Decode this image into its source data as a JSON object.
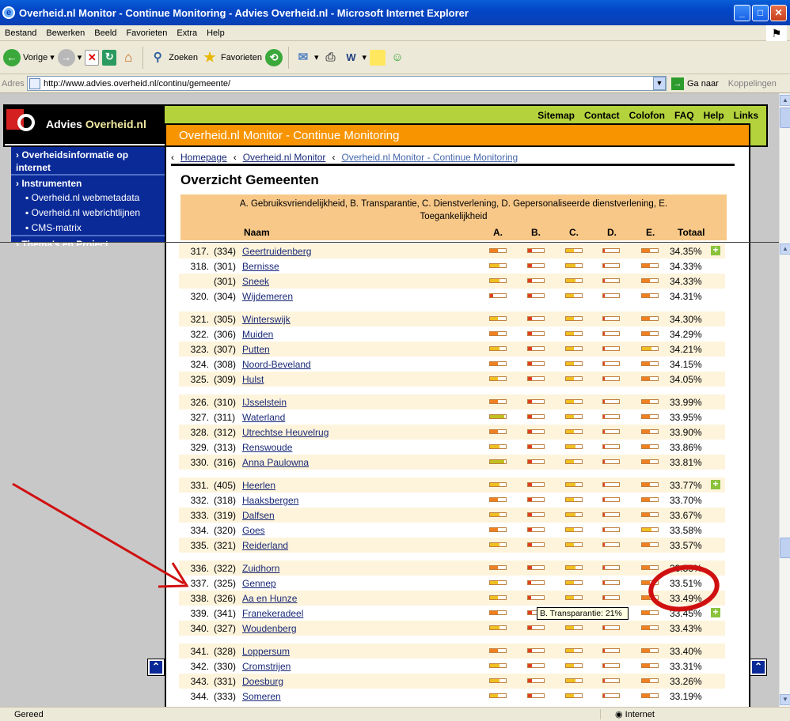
{
  "window": {
    "title": "Overheid.nl Monitor - Continue Monitoring - Advies Overheid.nl - Microsoft Internet Explorer"
  },
  "menu": [
    "Bestand",
    "Bewerken",
    "Beeld",
    "Favorieten",
    "Extra",
    "Help"
  ],
  "toolbar": {
    "back": "Vorige",
    "search": "Zoeken",
    "favorites": "Favorieten"
  },
  "address": {
    "label": "Adres",
    "url": "http://www.advies.overheid.nl/continu/gemeente/",
    "go": "Ga naar",
    "links": "Koppelingen"
  },
  "status": {
    "text": "Gereed",
    "zone": "Internet"
  },
  "site": {
    "logo_pre": "Advies ",
    "logo_post": "Overheid.nl",
    "top_links": [
      "Sitemap",
      "Contact",
      "Colofon",
      "FAQ",
      "Help",
      "Links"
    ],
    "banner": "Overheid.nl Monitor - Continue Monitoring",
    "sidebar": {
      "heading1": "Overheidsinformatie op internet",
      "heading2": "Instrumenten",
      "sub": [
        "▪ Overheid.nl webmetadata",
        "▪ Overheid.nl webrichtlijnen",
        "▪ CMS-matrix"
      ],
      "heading3": "Thema's en Project"
    },
    "breadcrumb": [
      "Homepage",
      "Overheid.nl Monitor",
      "Overheid.nl Monitor - Continue Monitoring"
    ],
    "title": "Overzicht Gemeenten",
    "legend": "A. Gebruiksvriendelijkheid, B. Transparantie, C. Dienstverlening, D. Gepersonaliseerde dienstverlening, E. Toegankelijkheid",
    "columns": {
      "name": "Naam",
      "a": "A.",
      "b": "B.",
      "c": "C.",
      "d": "D.",
      "e": "E.",
      "total": "Totaal"
    },
    "tooltip": "B. Transparantie: 21%"
  },
  "bar_colors": {
    "y": "#f0c020",
    "o": "#f08020",
    "r": "#e04020",
    "g": "#c0c020"
  },
  "rows": [
    {
      "rank": "317.",
      "prev": "(334)",
      "name": "Geertruidenberg",
      "total": "34.35%",
      "bars": [
        "o",
        "r",
        "y",
        "r",
        "o"
      ],
      "fill": [
        0.5,
        0.25,
        0.5,
        0.1,
        0.5
      ],
      "plus": true
    },
    {
      "rank": "318.",
      "prev": "(301)",
      "name": "Bernisse",
      "total": "34.33%",
      "bars": [
        "y",
        "r",
        "y",
        "r",
        "o"
      ],
      "fill": [
        0.6,
        0.25,
        0.6,
        0.1,
        0.5
      ]
    },
    {
      "rank": "",
      "prev": "(301)",
      "name": "Sneek",
      "total": "34.33%",
      "bars": [
        "y",
        "r",
        "y",
        "r",
        "o"
      ],
      "fill": [
        0.6,
        0.25,
        0.6,
        0.1,
        0.5
      ]
    },
    {
      "rank": "320.",
      "prev": "(304)",
      "name": "Wijdemeren",
      "total": "34.31%",
      "bars": [
        "r",
        "r",
        "y",
        "r",
        "o"
      ],
      "fill": [
        0.2,
        0.25,
        0.5,
        0.1,
        0.5
      ]
    },
    {
      "gap": true
    },
    {
      "rank": "321.",
      "prev": "(305)",
      "name": "Winterswijk",
      "total": "34.30%",
      "bars": [
        "y",
        "r",
        "y",
        "r",
        "o"
      ],
      "fill": [
        0.5,
        0.25,
        0.5,
        0.1,
        0.5
      ]
    },
    {
      "rank": "322.",
      "prev": "(306)",
      "name": "Muiden",
      "total": "34.29%",
      "bars": [
        "o",
        "r",
        "y",
        "r",
        "o"
      ],
      "fill": [
        0.5,
        0.25,
        0.5,
        0.1,
        0.5
      ]
    },
    {
      "rank": "323.",
      "prev": "(307)",
      "name": "Putten",
      "total": "34.21%",
      "bars": [
        "y",
        "r",
        "y",
        "r",
        "y"
      ],
      "fill": [
        0.6,
        0.25,
        0.5,
        0.1,
        0.6
      ]
    },
    {
      "rank": "324.",
      "prev": "(308)",
      "name": "Noord-Beveland",
      "total": "34.15%",
      "bars": [
        "o",
        "r",
        "y",
        "r",
        "o"
      ],
      "fill": [
        0.5,
        0.25,
        0.5,
        0.1,
        0.5
      ]
    },
    {
      "rank": "325.",
      "prev": "(309)",
      "name": "Hulst",
      "total": "34.05%",
      "bars": [
        "y",
        "r",
        "y",
        "r",
        "o"
      ],
      "fill": [
        0.5,
        0.25,
        0.5,
        0.1,
        0.5
      ]
    },
    {
      "gap": true
    },
    {
      "rank": "326.",
      "prev": "(310)",
      "name": "IJsselstein",
      "total": "33.99%",
      "bars": [
        "o",
        "r",
        "y",
        "r",
        "o"
      ],
      "fill": [
        0.5,
        0.25,
        0.5,
        0.1,
        0.5
      ]
    },
    {
      "rank": "327.",
      "prev": "(311)",
      "name": "Waterland",
      "total": "33.95%",
      "bars": [
        "g",
        "r",
        "y",
        "r",
        "o"
      ],
      "fill": [
        0.9,
        0.25,
        0.5,
        0.1,
        0.5
      ]
    },
    {
      "rank": "328.",
      "prev": "(312)",
      "name": "Utrechtse Heuvelrug",
      "total": "33.90%",
      "bars": [
        "o",
        "r",
        "y",
        "r",
        "o"
      ],
      "fill": [
        0.5,
        0.25,
        0.5,
        0.1,
        0.5
      ]
    },
    {
      "rank": "329.",
      "prev": "(313)",
      "name": "Renswoude",
      "total": "33.86%",
      "bars": [
        "y",
        "r",
        "y",
        "r",
        "o"
      ],
      "fill": [
        0.6,
        0.25,
        0.6,
        0.1,
        0.5
      ]
    },
    {
      "rank": "330.",
      "prev": "(316)",
      "name": "Anna Paulowna",
      "total": "33.81%",
      "bars": [
        "g",
        "r",
        "y",
        "r",
        "o"
      ],
      "fill": [
        0.9,
        0.25,
        0.5,
        0.1,
        0.5
      ]
    },
    {
      "gap": true
    },
    {
      "rank": "331.",
      "prev": "(405)",
      "name": "Heerlen",
      "total": "33.77%",
      "bars": [
        "y",
        "r",
        "y",
        "r",
        "o"
      ],
      "fill": [
        0.6,
        0.25,
        0.6,
        0.1,
        0.5
      ],
      "plus": true
    },
    {
      "rank": "332.",
      "prev": "(318)",
      "name": "Haaksbergen",
      "total": "33.70%",
      "bars": [
        "o",
        "r",
        "y",
        "r",
        "o"
      ],
      "fill": [
        0.5,
        0.25,
        0.5,
        0.1,
        0.5
      ]
    },
    {
      "rank": "333.",
      "prev": "(319)",
      "name": "Dalfsen",
      "total": "33.67%",
      "bars": [
        "y",
        "r",
        "y",
        "r",
        "o"
      ],
      "fill": [
        0.6,
        0.25,
        0.6,
        0.1,
        0.5
      ]
    },
    {
      "rank": "334.",
      "prev": "(320)",
      "name": "Goes",
      "total": "33.58%",
      "bars": [
        "o",
        "r",
        "y",
        "r",
        "y"
      ],
      "fill": [
        0.5,
        0.25,
        0.5,
        0.1,
        0.6
      ]
    },
    {
      "rank": "335.",
      "prev": "(321)",
      "name": "Reiderland",
      "total": "33.57%",
      "bars": [
        "y",
        "r",
        "y",
        "r",
        "o"
      ],
      "fill": [
        0.6,
        0.25,
        0.5,
        0.1,
        0.5
      ]
    },
    {
      "gap": true
    },
    {
      "rank": "336.",
      "prev": "(322)",
      "name": "Zuidhorn",
      "total": "33.53%",
      "bars": [
        "o",
        "r",
        "y",
        "r",
        "o"
      ],
      "fill": [
        0.5,
        0.25,
        0.6,
        0.1,
        0.5
      ]
    },
    {
      "rank": "337.",
      "prev": "(325)",
      "name": "Gennep",
      "total": "33.51%",
      "bars": [
        "y",
        "r",
        "y",
        "r",
        "o"
      ],
      "fill": [
        0.5,
        0.21,
        0.5,
        0.1,
        0.5
      ]
    },
    {
      "rank": "338.",
      "prev": "(326)",
      "name": "Aa en Hunze",
      "total": "33.49%",
      "bars": [
        "y",
        "r",
        "y",
        "r",
        "o"
      ],
      "fill": [
        0.5,
        0.21,
        0.5,
        0.1,
        0.5
      ]
    },
    {
      "rank": "339.",
      "prev": "(341)",
      "name": "Franekeradeel",
      "total": "33.45%",
      "bars": [
        "o",
        "r",
        "y",
        "r",
        "o"
      ],
      "fill": [
        0.5,
        0.25,
        0.5,
        0.1,
        0.5
      ],
      "plus": true
    },
    {
      "rank": "340.",
      "prev": "(327)",
      "name": "Woudenberg",
      "total": "33.43%",
      "bars": [
        "y",
        "r",
        "y",
        "r",
        "o"
      ],
      "fill": [
        0.6,
        0.25,
        0.5,
        0.1,
        0.5
      ]
    },
    {
      "gap": true
    },
    {
      "rank": "341.",
      "prev": "(328)",
      "name": "Loppersum",
      "total": "33.40%",
      "bars": [
        "o",
        "r",
        "y",
        "r",
        "o"
      ],
      "fill": [
        0.5,
        0.25,
        0.5,
        0.1,
        0.5
      ]
    },
    {
      "rank": "342.",
      "prev": "(330)",
      "name": "Cromstrijen",
      "total": "33.31%",
      "bars": [
        "y",
        "r",
        "y",
        "r",
        "o"
      ],
      "fill": [
        0.6,
        0.25,
        0.5,
        0.1,
        0.5
      ]
    },
    {
      "rank": "343.",
      "prev": "(331)",
      "name": "Doesburg",
      "total": "33.26%",
      "bars": [
        "y",
        "r",
        "y",
        "r",
        "o"
      ],
      "fill": [
        0.6,
        0.25,
        0.6,
        0.1,
        0.5
      ]
    },
    {
      "rank": "344.",
      "prev": "(333)",
      "name": "Someren",
      "total": "33.19%",
      "bars": [
        "y",
        "r",
        "y",
        "r",
        "o"
      ],
      "fill": [
        0.5,
        0.25,
        0.5,
        0.1,
        0.5
      ]
    }
  ]
}
